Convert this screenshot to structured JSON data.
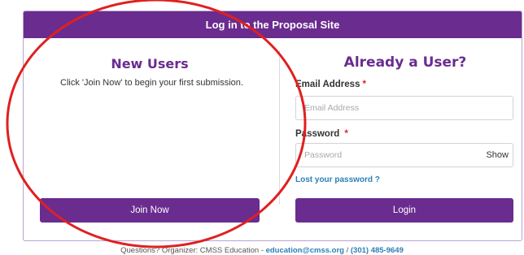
{
  "header": {
    "title": "Log in to the Proposal Site"
  },
  "new_users": {
    "title": "New Users",
    "description": "Click 'Join Now' to begin your first submission.",
    "join_label": "Join Now"
  },
  "existing_users": {
    "title": "Already a User?",
    "email_label": "Email Address",
    "email_placeholder": "Email Address",
    "password_label": "Password",
    "password_placeholder": "Password",
    "show_label": "Show",
    "lost_password": "Lost your password ?",
    "login_label": "Login",
    "required_marker": "*"
  },
  "footer": {
    "prefix": "Questions? Organizer: CMSS Education - ",
    "email": "education@cmss.org",
    "separator": " / ",
    "phone": "(301) 485-9649"
  },
  "colors": {
    "brand": "#6a2c8f",
    "link": "#2c7fb8",
    "required": "#d9213b",
    "annotation": "#e02020"
  }
}
